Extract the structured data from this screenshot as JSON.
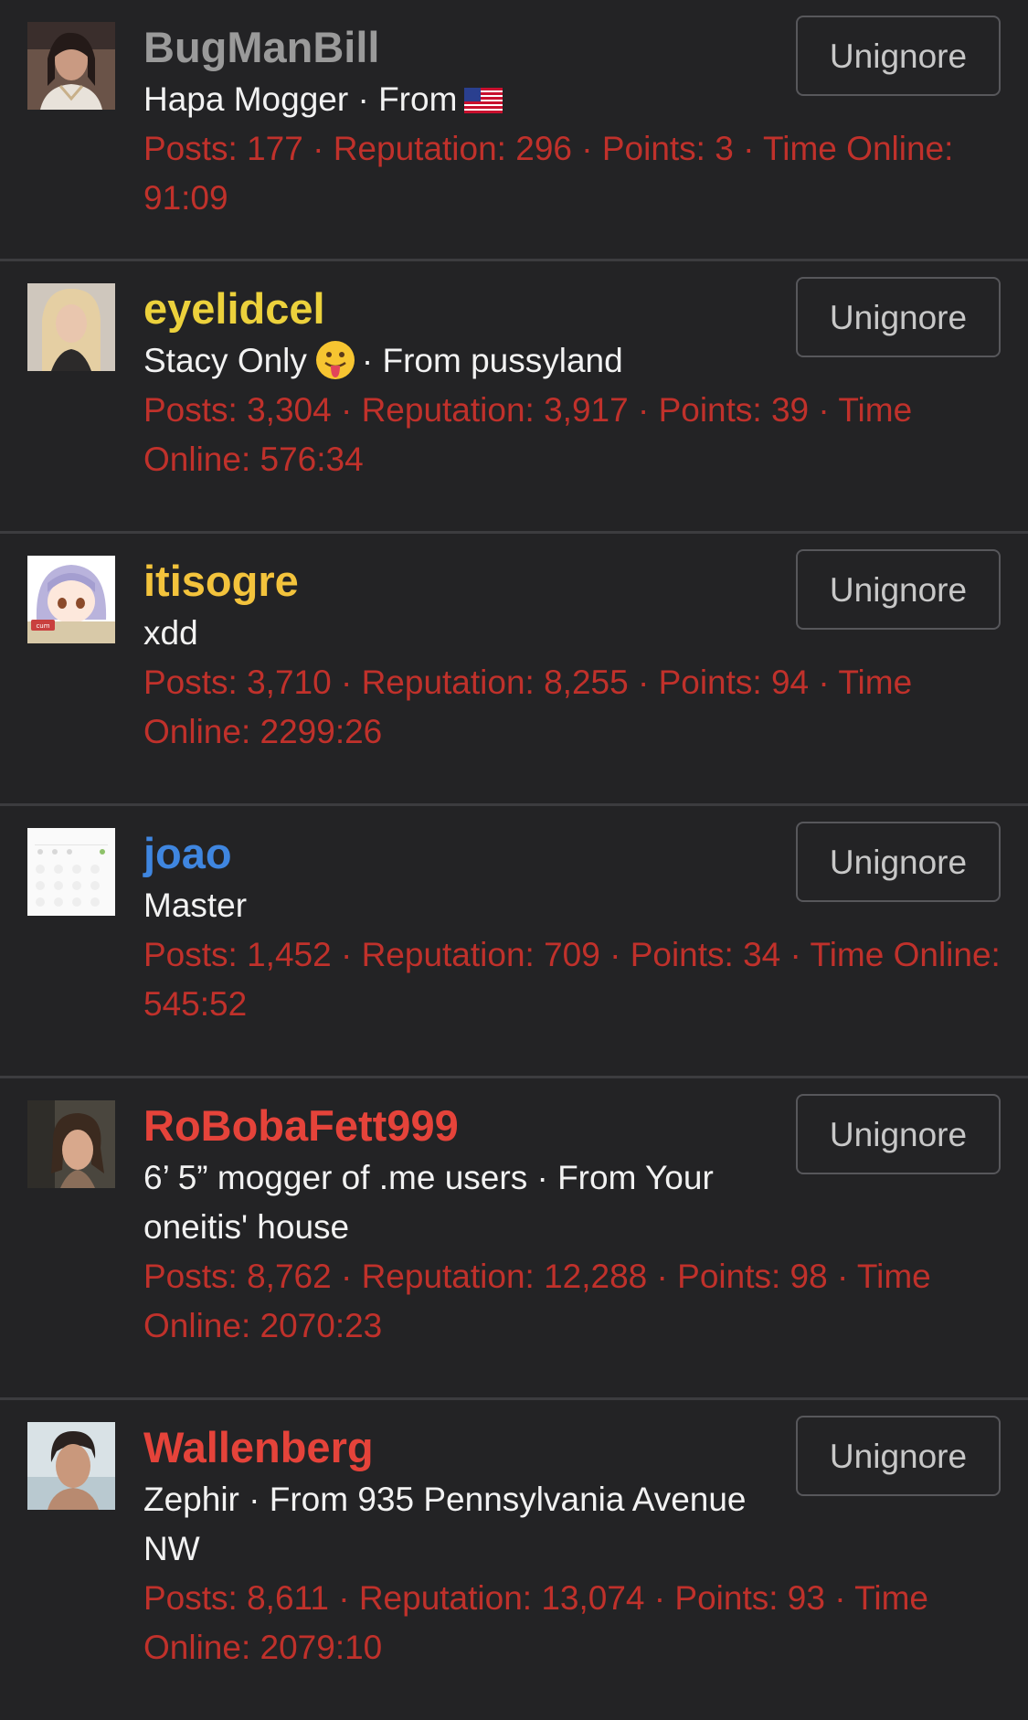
{
  "colors": {
    "background": "#232325",
    "stats": "#c0312b",
    "subtitle": "#f2f2f2",
    "button_border": "#57575b",
    "button_text": "#c8c8c8"
  },
  "button_label": "Unignore",
  "users": [
    {
      "name": "BugManBill",
      "name_color": "#9a9a9a",
      "subtitle": "Hapa Mogger · From",
      "subtitle_icon": "us-flag-icon",
      "stats": "Posts: 177 · Reputation: 296 · Points: 3 · Time Online: 91:09"
    },
    {
      "name": "eyelidcel",
      "name_color": "#ecd13c",
      "subtitle_pre": "Stacy Only",
      "subtitle_icon": "tongue-emoji-icon",
      "subtitle_post": "· From pussyland",
      "stats": "Posts: 3,304 · Reputation: 3,917 · Points: 39 · Time Online: 576:34"
    },
    {
      "name": "itisogre",
      "name_color": "#f3c33c",
      "subtitle": "xdd",
      "stats": "Posts: 3,710 · Reputation: 8,255 · Points: 94 · Time Online: 2299:26"
    },
    {
      "name": "joao",
      "name_color": "#3f86e0",
      "subtitle": "Master",
      "stats": "Posts: 1,452 · Reputation: 709 · Points: 34 · Time Online: 545:52"
    },
    {
      "name": "RoBobaFett999",
      "name_color": "#e5433a",
      "subtitle": "6’ 5” mogger of .me users · From Your oneitis' house",
      "stats": "Posts: 8,762 · Reputation: 12,288 · Points: 98 · Time Online: 2070:23"
    },
    {
      "name": "Wallenberg",
      "name_color": "#e5433a",
      "subtitle": "Zephir · From 935 Pennsylvania Avenue NW",
      "stats": "Posts: 8,611 · Reputation: 13,074 · Points: 93 · Time Online: 2079:10"
    }
  ]
}
